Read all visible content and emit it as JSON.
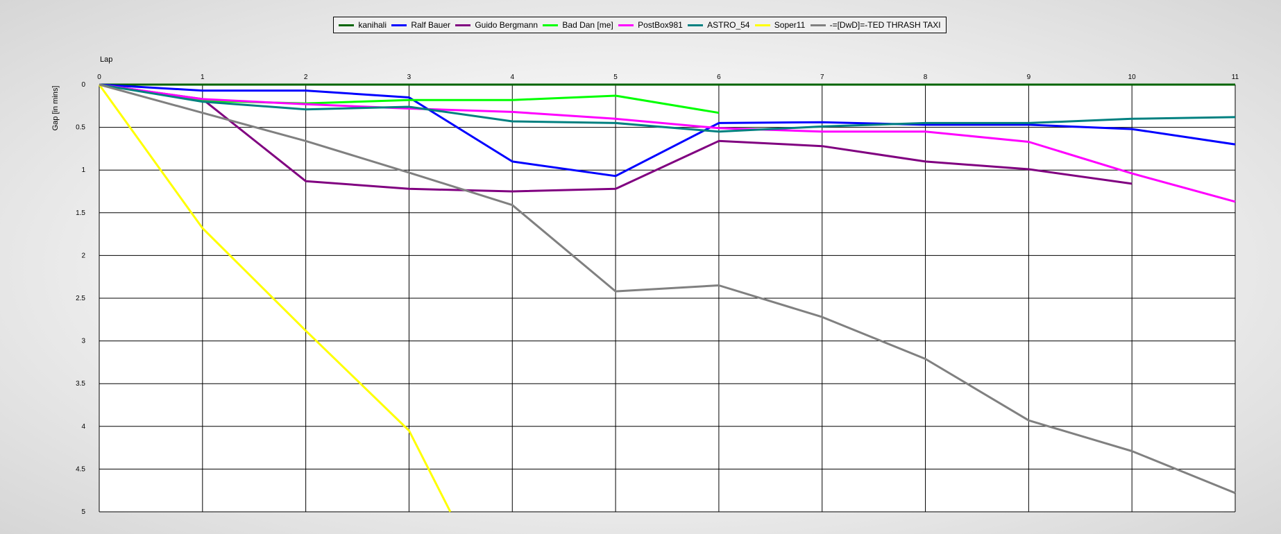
{
  "chart_data": {
    "type": "line",
    "title": "",
    "xlabel": "Lap",
    "ylabel": "Gap [in mins]",
    "x": [
      0,
      1,
      2,
      3,
      4,
      5,
      6,
      7,
      8,
      9,
      10,
      11
    ],
    "xlim": [
      0,
      11
    ],
    "ylim": [
      0,
      5
    ],
    "y_inverted": true,
    "x_axis_position": "top",
    "x_ticks": [
      "0",
      "1",
      "2",
      "3",
      "4",
      "5",
      "6",
      "7",
      "8",
      "9",
      "10",
      "11"
    ],
    "y_ticks": [
      "0",
      "0.5",
      "1",
      "1.5",
      "2",
      "2.5",
      "3",
      "3.5",
      "4",
      "4.5",
      "5"
    ],
    "grid": true,
    "legend_position": "top",
    "series": [
      {
        "name": "kanihali",
        "color": "#006400",
        "values": [
          0,
          0,
          0,
          0,
          0,
          0,
          0,
          0,
          0,
          0,
          0,
          0
        ]
      },
      {
        "name": "Ralf Bauer",
        "color": "#0000ff",
        "values": [
          0,
          0.07,
          0.07,
          0.15,
          0.9,
          1.07,
          0.45,
          0.44,
          0.47,
          0.47,
          0.52,
          0.7
        ]
      },
      {
        "name": "Guido Bergmann",
        "color": "#800080",
        "values": [
          0,
          0.17,
          1.13,
          1.22,
          1.25,
          1.22,
          0.66,
          0.72,
          0.9,
          0.99,
          1.16,
          null
        ]
      },
      {
        "name": "Bad Dan [me]",
        "color": "#00ff00",
        "values": [
          0,
          0.19,
          0.22,
          0.18,
          0.18,
          0.13,
          0.33,
          null,
          null,
          null,
          null,
          null
        ]
      },
      {
        "name": "PostBox981",
        "color": "#ff00ff",
        "values": [
          0,
          0.17,
          0.23,
          0.28,
          0.32,
          0.4,
          0.51,
          0.55,
          0.55,
          0.67,
          1.04,
          1.37
        ]
      },
      {
        "name": "ASTRO_54",
        "color": "#008080",
        "values": [
          0,
          0.2,
          0.29,
          0.26,
          0.43,
          0.45,
          0.55,
          0.49,
          0.45,
          0.45,
          0.4,
          0.38
        ]
      },
      {
        "name": "Soper11",
        "color": "#ffff00",
        "values": [
          0,
          1.68,
          2.88,
          4.05,
          null,
          null,
          null,
          null,
          null,
          null,
          null,
          null
        ],
        "end_point": {
          "x": 3.4,
          "y": 5.0
        }
      },
      {
        "name": "-=[DwD]=-TED THRASH TAXI",
        "color": "#808080",
        "values": [
          0,
          0.33,
          0.66,
          1.03,
          1.41,
          2.42,
          2.35,
          2.72,
          3.21,
          3.93,
          4.29,
          4.78
        ]
      }
    ]
  }
}
